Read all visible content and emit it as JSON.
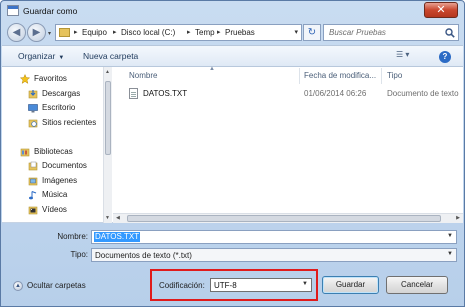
{
  "window": {
    "title": "Guardar como",
    "close_glyph": "✕"
  },
  "navbar": {
    "back_glyph": "◀",
    "forward_glyph": "▶",
    "recent_glyph": "▾",
    "breadcrumb": [
      "Equipo",
      "Disco local (C:)",
      "Temp",
      "Pruebas"
    ],
    "separator": "▸",
    "refresh_glyph": "↻",
    "search_placeholder": "Buscar Pruebas"
  },
  "toolbar": {
    "organize_label": "Organizar",
    "new_folder_label": "Nueva carpeta",
    "dropdown_glyph": "▼",
    "views_glyph": "☰ ▾",
    "help_glyph": "?"
  },
  "nav_pane": {
    "favorites": {
      "label": "Favoritos",
      "items": [
        "Descargas",
        "Escritorio",
        "Sitios recientes"
      ]
    },
    "libraries": {
      "label": "Bibliotecas",
      "items": [
        "Documentos",
        "Imágenes",
        "Música",
        "Vídeos"
      ]
    }
  },
  "file_list": {
    "columns": [
      "Nombre",
      "Fecha de modifica...",
      "Tipo"
    ],
    "sort_glyph": "▲",
    "rows": [
      {
        "name": "DATOS.TXT",
        "modified": "01/06/2014 06:26",
        "type": "Documento de texto"
      }
    ]
  },
  "form": {
    "name_label": "Nombre:",
    "name_value": "DATOS.TXT",
    "type_label": "Tipo:",
    "type_value": "Documentos de texto (*.txt)"
  },
  "footer": {
    "hide_folders_label": "Ocultar carpetas",
    "hide_glyph": "▲",
    "encoding_label": "Codificación:",
    "encoding_value": "UTF-8",
    "save_label": "Guardar",
    "cancel_label": "Cancelar"
  },
  "colors": {
    "highlight_border": "#e01b1b",
    "selection": "#3399ff",
    "accent": "#2c6bc5"
  }
}
